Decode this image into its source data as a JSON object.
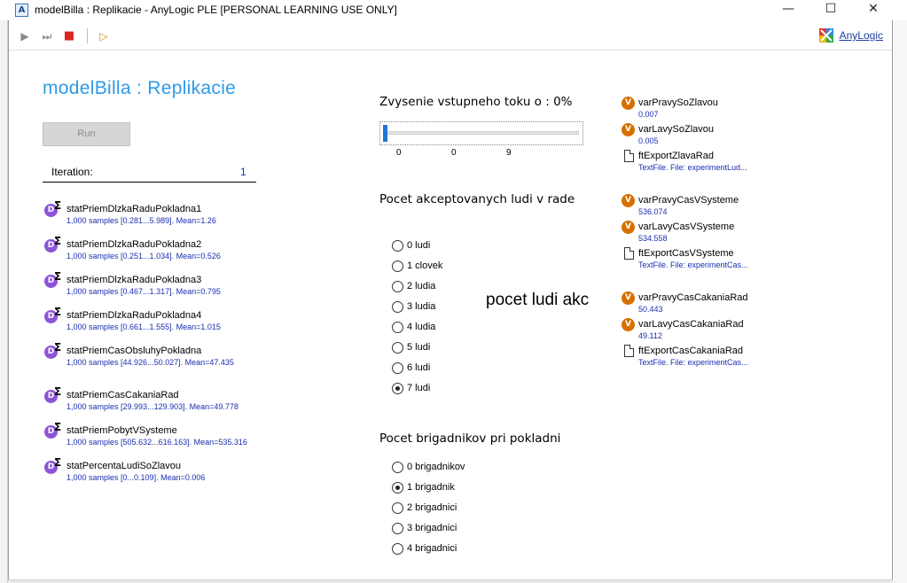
{
  "window": {
    "title": "modelBilla : Replikacie - AnyLogic PLE [PERSONAL LEARNING USE ONLY]",
    "minimize": "—",
    "maximize": "☐",
    "close": "✕"
  },
  "toolbar": {
    "anylogic_label": "AnyLogic"
  },
  "page": {
    "title": "modelBilla : Replikacie",
    "run_label": "Run",
    "iteration_label": "Iteration:",
    "iteration_value": "1"
  },
  "stats": [
    {
      "name": "statPriemDlzkaRaduPokladna1",
      "value": "1,000 samples [0.281...5.989]. Mean=1.26"
    },
    {
      "name": "statPriemDlzkaRaduPokladna2",
      "value": "1,000 samples [0.251...1.034]. Mean=0.526"
    },
    {
      "name": "statPriemDlzkaRaduPokladna3",
      "value": "1,000 samples [0.467...1.317]. Mean=0.795"
    },
    {
      "name": "statPriemDlzkaRaduPokladna4",
      "value": "1,000 samples [0.661...1.555]. Mean=1.015"
    },
    {
      "name": "statPriemCasObsluhyPokladna",
      "value": "1,000 samples [44.926...50.027]. Mean=47.435"
    },
    {
      "name": "statPriemCasCakaniaRad",
      "value": "1,000 samples [29.993...129.903]. Mean=49.778"
    },
    {
      "name": "statPriemPobytVSysteme",
      "value": "1,000 samples [505.632...616.163]. Mean=535.316"
    },
    {
      "name": "statPercentaLudiSoZlavou",
      "value": "1,000 samples [0...0.109]. Mean=0.006"
    }
  ],
  "slider": {
    "title": "Zvysenie vstupneho toku o : 0%",
    "value_fraction": 0,
    "tick_min": "0",
    "tick_current": "0",
    "tick_max": "9"
  },
  "queue_group": {
    "title": "Pocet akceptovanych ludi v rade",
    "options": [
      "0 ludi",
      "1 clovek",
      "2 ludia",
      "3 ludia",
      "4 ludia",
      "5 ludi",
      "6 ludi",
      "7 ludi"
    ],
    "selected_index": 7
  },
  "overlay_text": "pocet ludi akc",
  "workers_group": {
    "title": "Pocet brigadnikov pri pokladni",
    "options": [
      "0 brigadnikov",
      "1 brigadnik",
      "2 brigadnici",
      "3 brigadnici",
      "4 brigadnici"
    ],
    "selected_index": 1
  },
  "variables": [
    {
      "kind": "var",
      "name": "varPravySoZlavou",
      "value": "0.007"
    },
    {
      "kind": "var",
      "name": "varLavySoZlavou",
      "value": "0.005"
    },
    {
      "kind": "file",
      "name": "ftExportZlavaRad",
      "value": "TextFile. File: experimentLud..."
    },
    {
      "kind": "var",
      "name": "varPravyCasVSysteme",
      "value": "536.074"
    },
    {
      "kind": "var",
      "name": "varLavyCasVSysteme",
      "value": "534.558"
    },
    {
      "kind": "file",
      "name": "ftExportCasVSysteme",
      "value": "TextFile. File: experimentCas..."
    },
    {
      "kind": "var",
      "name": "varPravyCasCakaniaRad",
      "value": "50.443"
    },
    {
      "kind": "var",
      "name": "varLavyCasCakaniaRad",
      "value": "49.112"
    },
    {
      "kind": "file",
      "name": "ftExportCasCakaniaRad",
      "value": "TextFile. File: experimentCas..."
    }
  ],
  "colors": {
    "title_blue": "#2e9ae8",
    "value_blue": "#1a2fb0",
    "stat_icon": "#8c55d6",
    "var_icon": "#d66f00",
    "slider_thumb": "#1e74d6"
  }
}
